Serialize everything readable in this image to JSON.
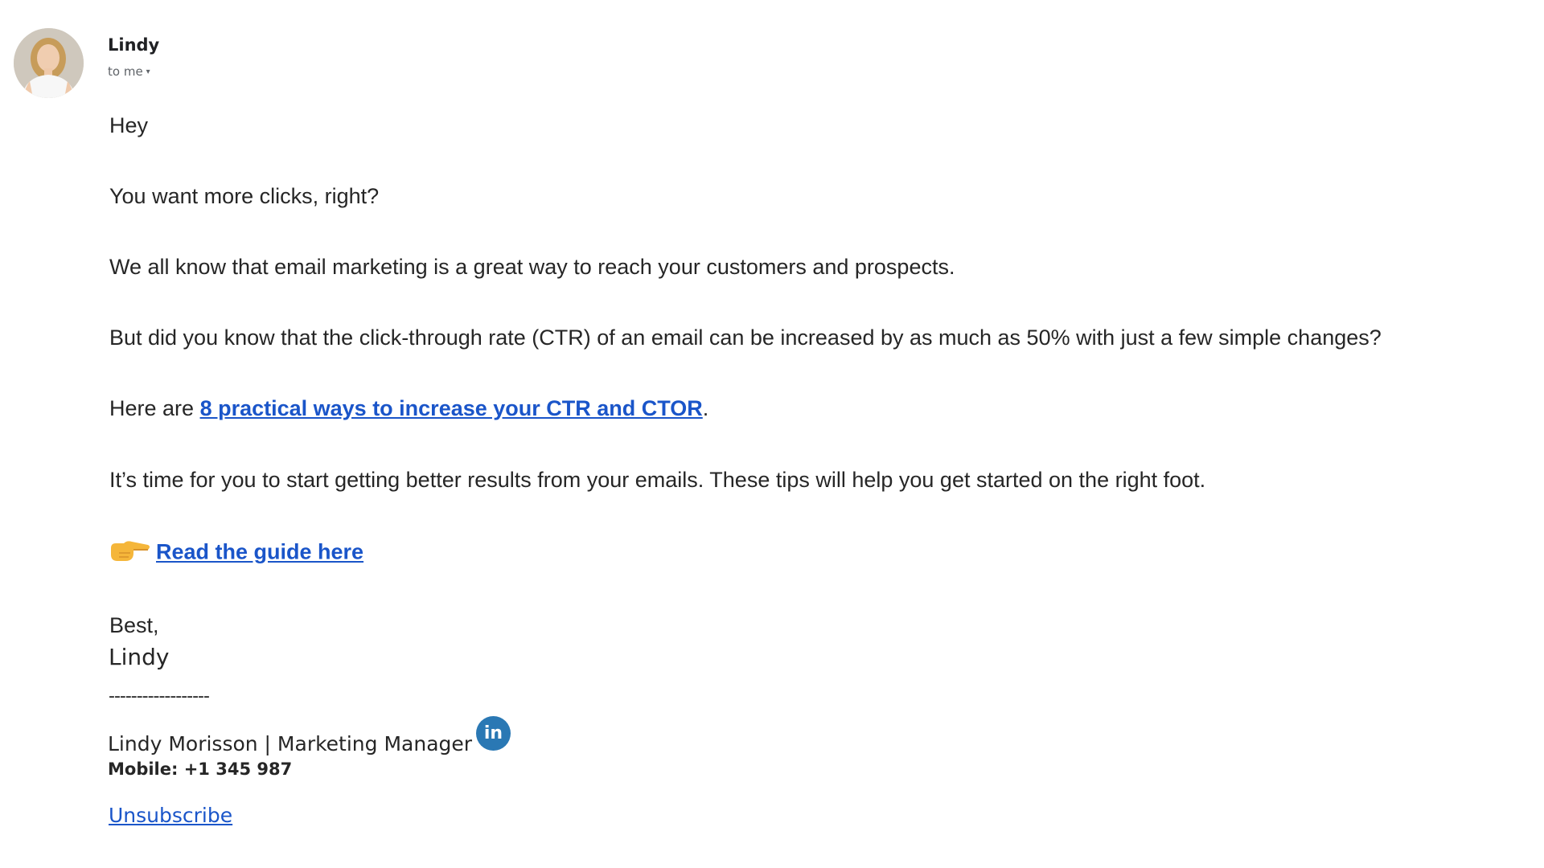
{
  "sender": {
    "name": "Lindy",
    "recipient_label": "to me",
    "caret": "▾"
  },
  "body": {
    "greeting": "Hey",
    "line1": "You want more clicks, right?",
    "line2": "We all know that email marketing is a great way to reach your customers and prospects.",
    "line3": "But did you know that the click-through rate (CTR) of an email can be increased by as much as 50% with just a few simple changes?",
    "line4_prefix": "Here are ",
    "line4_link": "8 practical ways to increase your CTR and CTOR",
    "line4_suffix": ".",
    "line5": "It’s time for you to start getting better results from your emails. These tips will help you get started on the right foot.",
    "guide_link": "Read the guide here",
    "closing": "Best,"
  },
  "signature": {
    "name": "Lindy",
    "divider": "------------------",
    "title": "Lindy Morisson | Marketing Manager",
    "linkedin_label": "in",
    "mobile": "Mobile: +1 345 987",
    "unsubscribe": "Unsubscribe"
  },
  "colors": {
    "link": "#1a55c9",
    "text": "#262626",
    "linkedin": "#2a78b4",
    "emoji": "#f5b63a"
  },
  "icons": {
    "avatar": "avatar-photo",
    "guide_pointer": "pointing-hand-icon",
    "linkedin": "linkedin-icon"
  }
}
